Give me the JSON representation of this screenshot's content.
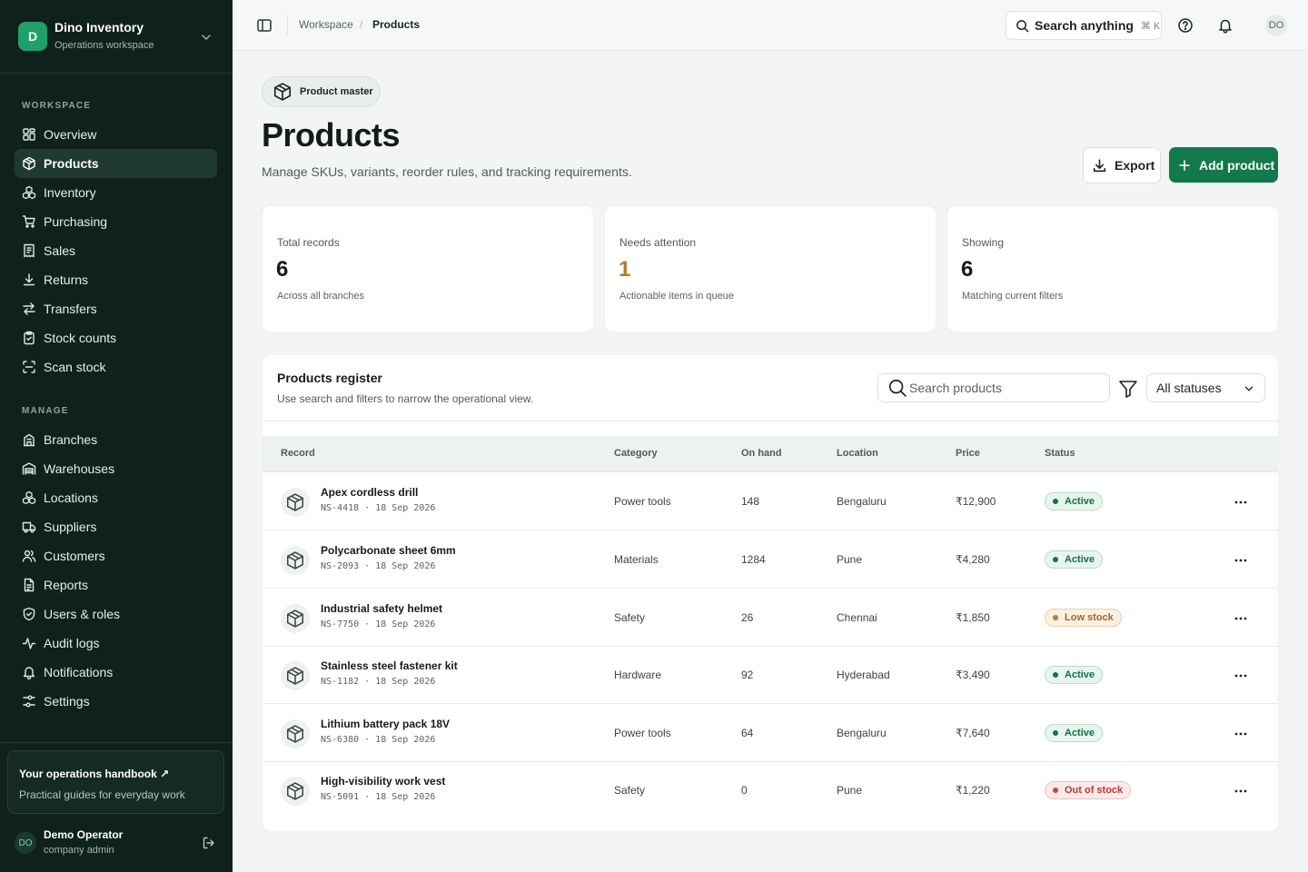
{
  "org": {
    "initial": "D",
    "name": "Dino Inventory",
    "subtitle": "Operations workspace"
  },
  "sidebar": {
    "workspace_heading": "WORKSPACE",
    "manage_heading": "MANAGE",
    "workspace_items": [
      {
        "label": "Overview",
        "icon": "grid-icon"
      },
      {
        "label": "Products",
        "icon": "box-icon",
        "active": true
      },
      {
        "label": "Inventory",
        "icon": "boxes-icon"
      },
      {
        "label": "Purchasing",
        "icon": "cart-icon"
      },
      {
        "label": "Sales",
        "icon": "receipt-icon"
      },
      {
        "label": "Returns",
        "icon": "download-icon"
      },
      {
        "label": "Transfers",
        "icon": "swap-icon"
      },
      {
        "label": "Stock counts",
        "icon": "clipboard-icon"
      },
      {
        "label": "Scan stock",
        "icon": "scan-icon"
      }
    ],
    "manage_items": [
      {
        "label": "Branches",
        "icon": "building-icon"
      },
      {
        "label": "Warehouses",
        "icon": "warehouse-icon"
      },
      {
        "label": "Locations",
        "icon": "boxes-icon"
      },
      {
        "label": "Suppliers",
        "icon": "truck-icon"
      },
      {
        "label": "Customers",
        "icon": "users-icon"
      },
      {
        "label": "Reports",
        "icon": "report-icon"
      },
      {
        "label": "Users & roles",
        "icon": "shield-icon"
      },
      {
        "label": "Audit logs",
        "icon": "activity-icon"
      },
      {
        "label": "Notifications",
        "icon": "bell-icon"
      },
      {
        "label": "Settings",
        "icon": "sliders-icon"
      }
    ],
    "handbook": {
      "title": "Your operations handbook ↗",
      "subtitle": "Practical guides for everyday work"
    },
    "user": {
      "initials": "DO",
      "name": "Demo Operator",
      "role": "company admin"
    }
  },
  "topbar": {
    "breadcrumb": [
      "Workspace",
      "Products"
    ],
    "breadcrumb_sep": "/",
    "search_label": "Search anything",
    "search_shortcut": "⌘ K",
    "avatar_initials": "DO"
  },
  "page": {
    "chip": "Product master",
    "title": "Products",
    "subtitle": "Manage SKUs, variants, reorder rules, and tracking requirements.",
    "export_label": "Export",
    "add_label": "Add product"
  },
  "stats": [
    {
      "label": "Total records",
      "value": "6",
      "sub": "Across all branches"
    },
    {
      "label": "Needs attention",
      "value": "1",
      "sub": "Actionable items in queue",
      "accent": "#b4792a"
    },
    {
      "label": "Showing",
      "value": "6",
      "sub": "Matching current filters"
    }
  ],
  "register": {
    "title": "Products register",
    "subtitle": "Use search and filters to narrow the operational view.",
    "search_placeholder": "Search products",
    "status_filter": "All statuses",
    "columns": [
      "Record",
      "Category",
      "On hand",
      "Location",
      "Price",
      "Status"
    ],
    "rows": [
      {
        "name": "Apex cordless drill",
        "meta": "NS-4418 · 18 Sep 2026",
        "category": "Power tools",
        "on_hand": "148",
        "location": "Bengaluru",
        "price": "₹12,900",
        "status": "Active",
        "status_kind": "active"
      },
      {
        "name": "Polycarbonate sheet 6mm",
        "meta": "NS-2093 · 18 Sep 2026",
        "category": "Materials",
        "on_hand": "1284",
        "location": "Pune",
        "price": "₹4,280",
        "status": "Active",
        "status_kind": "active"
      },
      {
        "name": "Industrial safety helmet",
        "meta": "NS-7750 · 18 Sep 2026",
        "category": "Safety",
        "on_hand": "26",
        "location": "Chennai",
        "price": "₹1,850",
        "status": "Low stock",
        "status_kind": "low"
      },
      {
        "name": "Stainless steel fastener kit",
        "meta": "NS-1182 · 18 Sep 2026",
        "category": "Hardware",
        "on_hand": "92",
        "location": "Hyderabad",
        "price": "₹3,490",
        "status": "Active",
        "status_kind": "active"
      },
      {
        "name": "Lithium battery pack 18V",
        "meta": "NS-6380 · 18 Sep 2026",
        "category": "Power tools",
        "on_hand": "64",
        "location": "Bengaluru",
        "price": "₹7,640",
        "status": "Active",
        "status_kind": "active"
      },
      {
        "name": "High-visibility work vest",
        "meta": "NS-5091 · 18 Sep 2026",
        "category": "Safety",
        "on_hand": "0",
        "location": "Pune",
        "price": "₹1,220",
        "status": "Out of stock",
        "status_kind": "out"
      }
    ]
  },
  "colors": {
    "sidebar_bg": "#10211b",
    "brand": "#13784b",
    "accent_warn": "#b4792a"
  }
}
